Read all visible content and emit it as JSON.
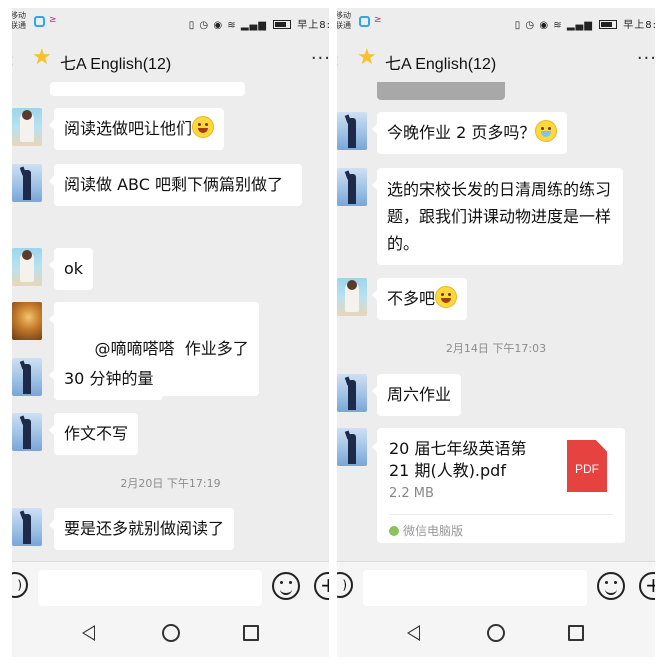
{
  "left": {
    "status": {
      "carrier": "移动\n联通",
      "time": "早上8:"
    },
    "title": "七A English(12)",
    "messages": [
      {
        "text": "阅读选做吧让他们",
        "emoji": true
      },
      {
        "text": "阅读做 ABC 吧剩下俩篇别做了"
      },
      {
        "text": "ok"
      },
      {
        "text": "@嘀嘀嗒嗒  作业多了"
      },
      {
        "text": "30 分钟的量"
      },
      {
        "text": "作文不写"
      },
      {
        "text": "要是还多就别做阅读了"
      }
    ],
    "timestamp": "2月20日 下午17:19"
  },
  "right": {
    "status": {
      "carrier": "移动\n联通",
      "time": "早上8:"
    },
    "title": "七A English(12)",
    "messages": [
      {
        "text": "今晚作业 2 页多吗？",
        "emoji": true
      },
      {
        "text": "选的宋校长发的日清周练的练习题，跟我们讲课动物进度是一样的。"
      },
      {
        "text": "不多吧",
        "emoji": true
      },
      {
        "text": "周六作业"
      }
    ],
    "timestamp": "2月14日 下午17:03",
    "file": {
      "name": "20 届七年级英语第 21 期(人教).pdf",
      "size": "2.2 MB",
      "icon_label": "PDF",
      "source": "微信电脑版"
    }
  },
  "colors": {
    "background": "#ededed",
    "bubble": "#ffffff",
    "pdf": "#e64340",
    "star": "#f6c12c"
  },
  "icons": [
    "back-icon",
    "star-icon",
    "more-icon",
    "voice-icon",
    "emoji-icon",
    "plus-icon",
    "nav-back-icon",
    "nav-home-icon",
    "nav-recent-icon",
    "pdf-icon"
  ]
}
